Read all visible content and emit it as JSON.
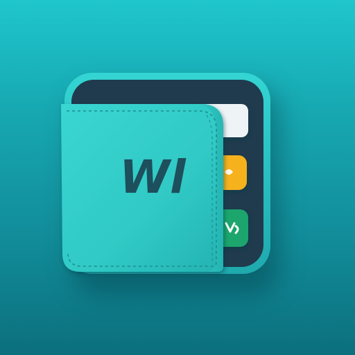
{
  "app_icon": {
    "name": "wallet-app-icon",
    "monogram": "Wl",
    "colors": {
      "background_top": "#1fc6cc",
      "background_bottom": "#0c6f7d",
      "frame_outer": "#2bc9c9",
      "frame_inner": "#1e3a4c",
      "wallet_body": "#33cfca",
      "stitching": "#1b8f8e",
      "monogram": "#1d4f5c",
      "card_white": "#eef3f5",
      "card_yellow": "#f6b21f",
      "card_green": "#1fa56d"
    }
  }
}
